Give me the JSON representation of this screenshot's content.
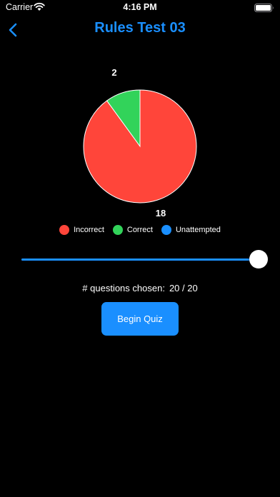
{
  "status_bar": {
    "carrier": "Carrier",
    "time": "4:16 PM"
  },
  "nav": {
    "title": "Rules Test 03",
    "back_icon": "chevron-left-icon"
  },
  "chart_data": {
    "type": "pie",
    "slices": [
      {
        "label": "Incorrect",
        "value": 18,
        "color": "#ff453a"
      },
      {
        "label": "Correct",
        "value": 2,
        "color": "#32d35a"
      },
      {
        "label": "Unattempted",
        "value": 0,
        "color": "#1a8fff"
      }
    ],
    "data_labels": [
      "18",
      "2"
    ],
    "legend_placement": "bottom"
  },
  "legend": [
    {
      "label": "Incorrect",
      "color": "#ff453a"
    },
    {
      "label": "Correct",
      "color": "#32d35a"
    },
    {
      "label": "Unattempted",
      "color": "#1a8fff"
    }
  ],
  "slider": {
    "value": 20,
    "max": 20
  },
  "count": {
    "label": "# questions chosen:",
    "value": "20 / 20"
  },
  "begin_button": {
    "label": "Begin Quiz"
  },
  "colors": {
    "accent": "#1a8fff",
    "background": "#000000"
  }
}
